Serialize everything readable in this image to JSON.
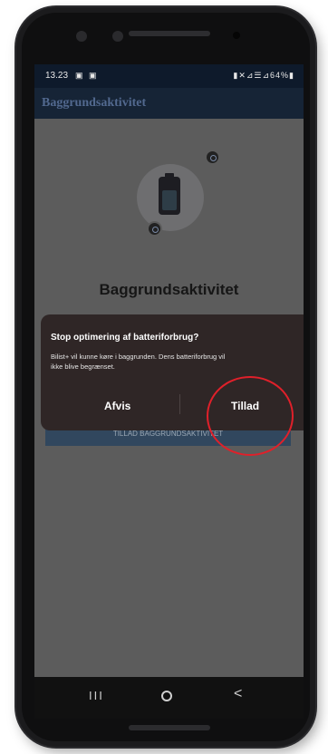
{
  "statusbar": {
    "time": "13.23",
    "left_icons": "▣ ▣",
    "right": "▮✕⊿☰⊿64%▮"
  },
  "appbar": {
    "title": "Baggrundsaktivitet"
  },
  "screen": {
    "heading": "Baggrundsaktivitet",
    "background_button_label": "TILLAD BAGGRUNDSAKTIVITET"
  },
  "dialog": {
    "title": "Stop optimering af batteriforbrug?",
    "body": "Bilist+ vil kunne køre i baggrunden. Dens batteriforbrug vil ikke blive begrænset.",
    "deny_label": "Afvis",
    "allow_label": "Tillad"
  },
  "navbar": {
    "recent": "III",
    "back": "<"
  },
  "icons": [
    "battery-icon",
    "settings-badge-icon",
    "add-badge-icon",
    "recent-apps-icon",
    "home-icon",
    "back-icon"
  ],
  "colors": {
    "highlight": "#e0202a",
    "appbar": "#162436",
    "dialog": "#2f2626"
  }
}
